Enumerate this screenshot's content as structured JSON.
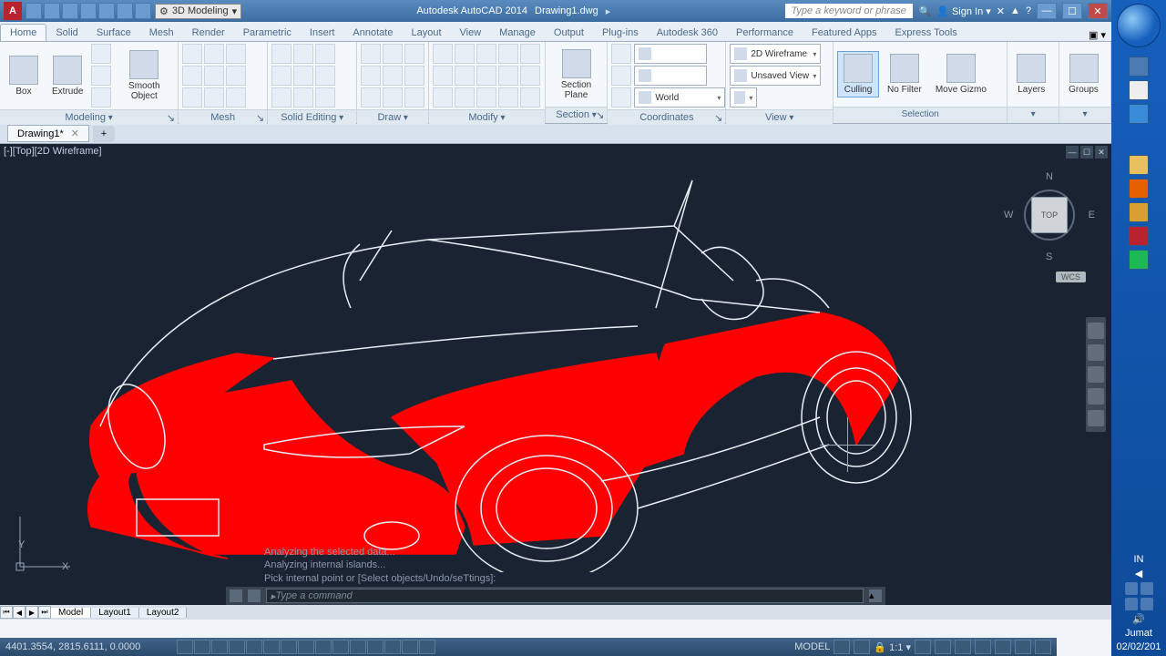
{
  "titlebar": {
    "workspace": "3D Modeling",
    "app_name": "Autodesk AutoCAD 2014",
    "file_name": "Drawing1.dwg",
    "search_placeholder": "Type a keyword or phrase",
    "signin": "Sign In"
  },
  "ribbon": {
    "tabs": [
      "Home",
      "Solid",
      "Surface",
      "Mesh",
      "Render",
      "Parametric",
      "Insert",
      "Annotate",
      "Layout",
      "View",
      "Manage",
      "Output",
      "Plug-ins",
      "Autodesk 360",
      "Performance",
      "Featured Apps",
      "Express Tools"
    ],
    "active_tab": "Home",
    "panels": {
      "modeling": {
        "label": "Modeling",
        "btn_box": "Box",
        "btn_extrude": "Extrude",
        "btn_smooth": "Smooth Object"
      },
      "mesh": {
        "label": "Mesh"
      },
      "solid_editing": {
        "label": "Solid Editing"
      },
      "draw": {
        "label": "Draw"
      },
      "modify": {
        "label": "Modify"
      },
      "section": {
        "label": "Section",
        "btn_section": "Section Plane"
      },
      "coordinates": {
        "label": "Coordinates",
        "ucs": "World"
      },
      "view": {
        "label": "View",
        "visual_style": "2D Wireframe",
        "unsaved": "Unsaved View"
      },
      "selection": {
        "label": "Selection",
        "btn_culling": "Culling",
        "btn_nofilter": "No Filter",
        "btn_gizmo": "Move Gizmo"
      },
      "layers": {
        "btn": "Layers"
      },
      "groups": {
        "btn": "Groups"
      }
    }
  },
  "doc_tab": {
    "name": "Drawing1*"
  },
  "viewport": {
    "label": "[-][Top][2D Wireframe]",
    "viewcube_face": "TOP",
    "wcs": "WCS",
    "dirs": {
      "n": "N",
      "s": "S",
      "e": "E",
      "w": "W"
    },
    "ucs": {
      "x": "X",
      "y": "Y"
    }
  },
  "command": {
    "history": [
      "Analyzing the selected data...",
      "Analyzing internal islands...",
      "Pick internal point or [Select objects/Undo/seTtings]:"
    ],
    "placeholder": "Type a command"
  },
  "layout_tabs": {
    "model": "Model",
    "l1": "Layout1",
    "l2": "Layout2"
  },
  "status": {
    "coords": "4401.3554, 2815.6111, 0.0000",
    "scale": "1:1",
    "in": "IN"
  },
  "taskbar": {
    "day": "Jumat",
    "date": "02/02/201"
  }
}
